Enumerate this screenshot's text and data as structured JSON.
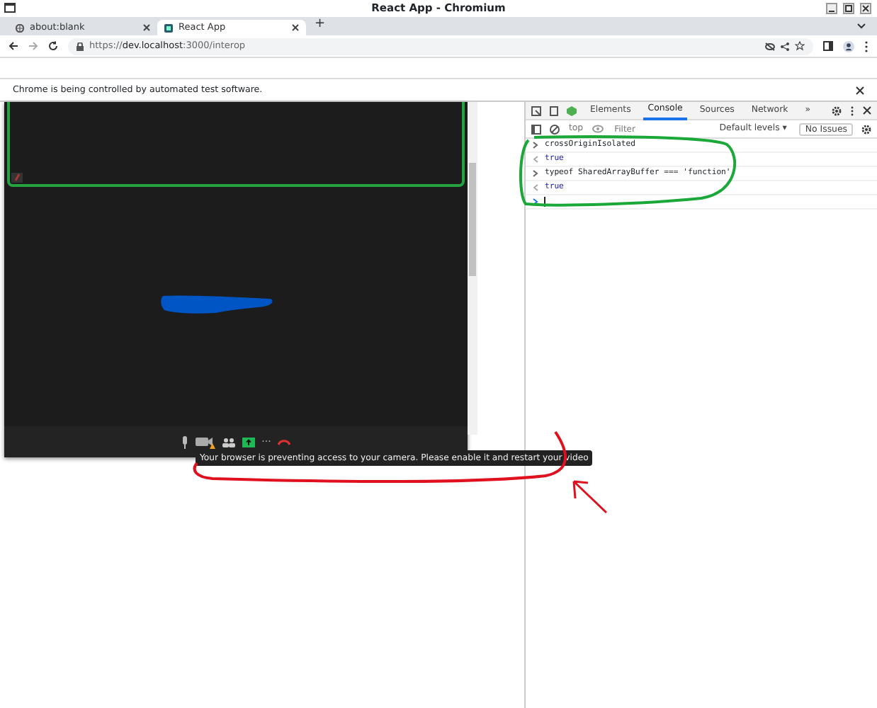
{
  "window": {
    "title": "React App - Chromium"
  },
  "tabs": [
    {
      "label": "about:blank",
      "selected": false
    },
    {
      "label": "React App",
      "selected": true
    }
  ],
  "new_tab": "+",
  "address_bar": {
    "scheme": "https://",
    "host": "dev.localhost",
    "rest": ":3000/interop"
  },
  "infobar": {
    "text": "Chrome is being controlled by automated test software."
  },
  "video_call": {
    "tooltip": "Your browser is preventing access to your camera. Please enable it and restart your video",
    "more": "···"
  },
  "devtools": {
    "tabs": [
      {
        "label": "Elements",
        "selected": false
      },
      {
        "label": "Console",
        "selected": true
      },
      {
        "label": "Sources",
        "selected": false
      },
      {
        "label": "Network",
        "selected": false
      }
    ],
    "overflow": "»",
    "context": "top",
    "filter_placeholder": "Filter",
    "levels": "Default levels ▾",
    "issues": "No Issues",
    "console": [
      {
        "kind": "input",
        "text": "crossOriginIsolated"
      },
      {
        "kind": "output",
        "text": "true"
      },
      {
        "kind": "input",
        "text": "typeof SharedArrayBuffer === 'function'"
      },
      {
        "kind": "output",
        "text": "true"
      },
      {
        "kind": "prompt"
      }
    ]
  }
}
